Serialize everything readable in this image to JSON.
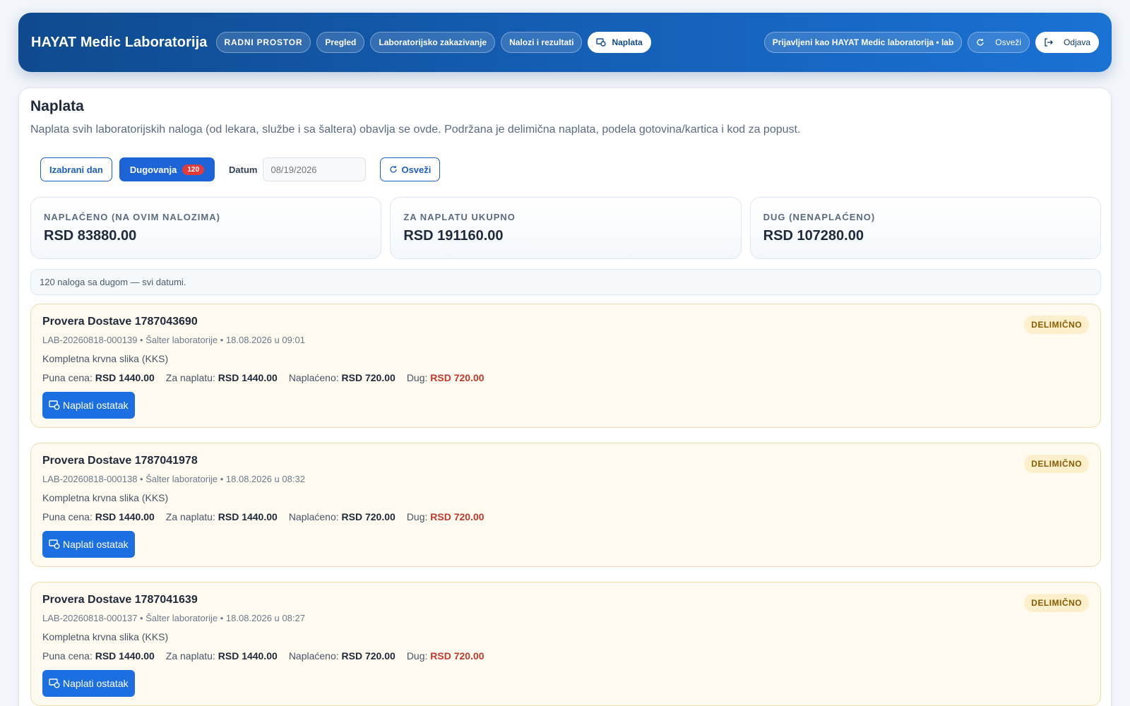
{
  "header": {
    "brand": "HAYAT Medic Laboratorija",
    "nav": [
      {
        "label": "RADNI PROSTOR"
      },
      {
        "label": "Pregled"
      },
      {
        "label": "Laboratorijsko zakazivanje"
      },
      {
        "label": "Nalozi i rezultati"
      },
      {
        "label": "Naplata",
        "active": true,
        "icon": "payment-icon"
      }
    ],
    "user_label": "Prijavljeni kao HAYAT Medic laboratorija • lab",
    "refresh_label": "Osveži",
    "logout_label": "Odjava",
    "colors": {
      "gradient_start": "#0f4a8f",
      "gradient_end": "#1a72d4"
    }
  },
  "page": {
    "title": "Naplata",
    "description": "Naplata svih laboratorijskih naloga (od lekara, službe i sa šaltera) obavlja se ovde. Podržana je delimična naplata, podela gotovina/kartica i kod za popust."
  },
  "filters": {
    "selected_day_label": "Izabrani dan",
    "debts_label": "Dugovanja",
    "debts_count": "120",
    "date_label": "Datum",
    "date_placeholder": "08/19/2026",
    "refresh_label": "Osveži"
  },
  "stats": [
    {
      "label": "NAPLAĆENO (NA OVIM NALOZIMA)",
      "value": "RSD 83880.00"
    },
    {
      "label": "ZA NAPLATU UKUPNO",
      "value": "RSD 191160.00"
    },
    {
      "label": "DUG (NENAPLAĆENO)",
      "value": "RSD 107280.00"
    }
  ],
  "info": "120 naloga sa dugom — svi datumi.",
  "labels": {
    "full_price": "Puna cena:",
    "to_pay": "Za naplatu:",
    "paid": "Naplaćeno:",
    "debt": "Dug:",
    "pay_button": "Naplati ostatak",
    "status": "DELIMIČNO"
  },
  "orders": [
    {
      "title": "Provera Dostave 1787043690",
      "meta": "LAB-20260818-000139 • Šalter laboratorije • 18.08.2026 u 09:01",
      "test": "Kompletna krvna slika (KKS)",
      "full_price": "RSD 1440.00",
      "to_pay": "RSD 1440.00",
      "paid": "RSD 720.00",
      "debt": "RSD 720.00"
    },
    {
      "title": "Provera Dostave 1787041978",
      "meta": "LAB-20260818-000138 • Šalter laboratorije • 18.08.2026 u 08:32",
      "test": "Kompletna krvna slika (KKS)",
      "full_price": "RSD 1440.00",
      "to_pay": "RSD 1440.00",
      "paid": "RSD 720.00",
      "debt": "RSD 720.00"
    },
    {
      "title": "Provera Dostave 1787041639",
      "meta": "LAB-20260818-000137 • Šalter laboratorije • 18.08.2026 u 08:27",
      "test": "Kompletna krvna slika (KKS)",
      "full_price": "RSD 1440.00",
      "to_pay": "RSD 1440.00",
      "paid": "RSD 720.00",
      "debt": "RSD 720.00"
    }
  ]
}
